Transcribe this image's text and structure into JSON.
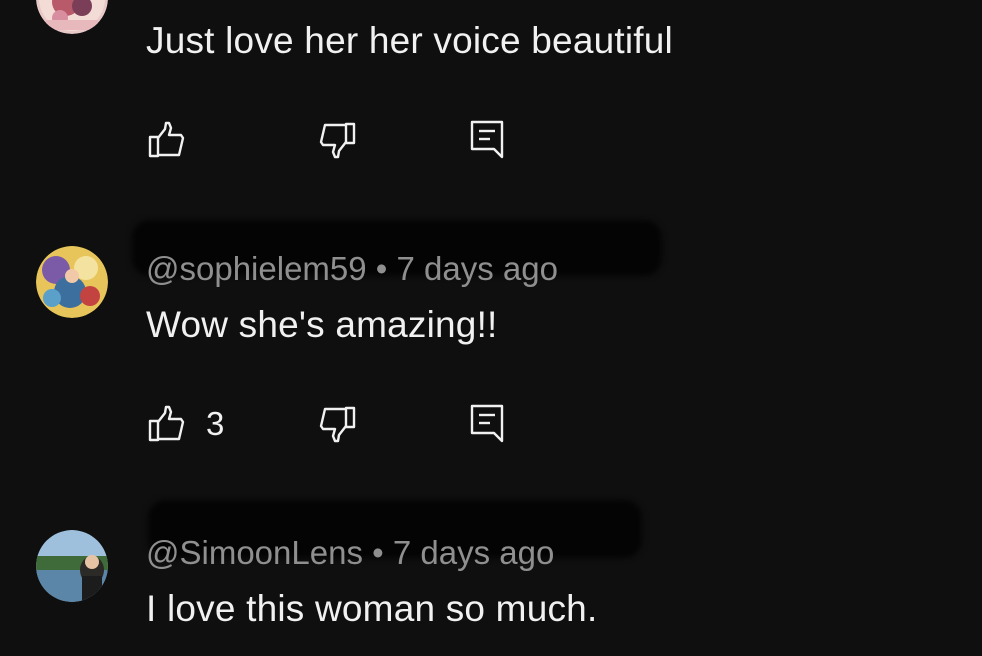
{
  "comments": [
    {
      "author": "",
      "age": "",
      "text": "Just love her her voice beautiful",
      "likes": ""
    },
    {
      "author": "@sophielem59",
      "age": "7 days ago",
      "text": "Wow she's amazing!!",
      "likes": "3"
    },
    {
      "author": "@SimoonLens",
      "age": "7 days ago",
      "text": "I love this woman so much.",
      "likes": ""
    }
  ],
  "separator": "•",
  "icons": {
    "like": "thumbs-up-icon",
    "dislike": "thumbs-down-icon",
    "reply": "reply-comment-icon"
  },
  "colors": {
    "background": "#0f0f0f",
    "text": "#f1f1f1",
    "meta": "#8f8f8f",
    "redaction": "#040404"
  }
}
